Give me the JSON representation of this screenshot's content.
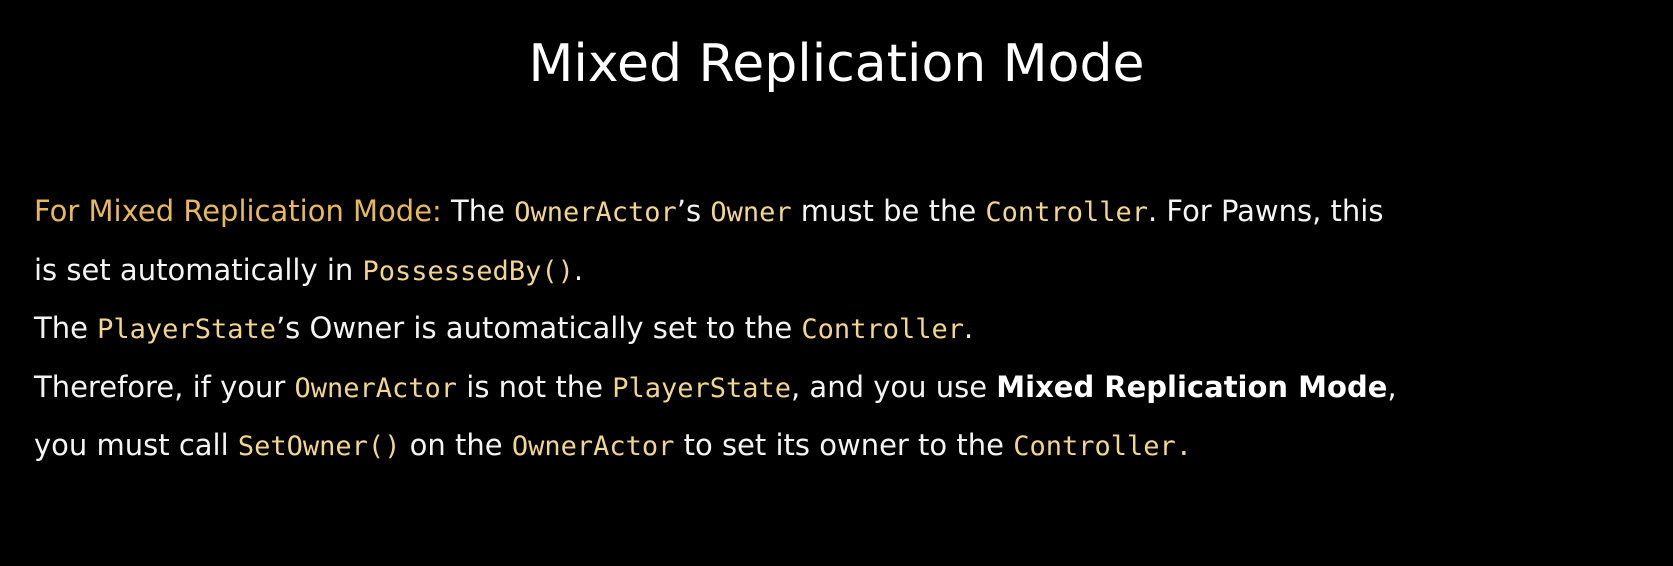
{
  "title": "Mixed Replication Mode",
  "lines": [
    [
      {
        "t": "For Mixed Replication Mode:",
        "s": "lead"
      },
      {
        "t": " The ",
        "s": "text"
      },
      {
        "t": "OwnerActor",
        "s": "code"
      },
      {
        "t": "’s ",
        "s": "text"
      },
      {
        "t": "Owner",
        "s": "code"
      },
      {
        "t": " must be the ",
        "s": "text"
      },
      {
        "t": "Controller",
        "s": "code"
      },
      {
        "t": ". For Pawns, this",
        "s": "text"
      }
    ],
    [
      {
        "t": "is set automatically in ",
        "s": "text"
      },
      {
        "t": "PossessedBy()",
        "s": "code"
      },
      {
        "t": ".",
        "s": "text"
      }
    ],
    [
      {
        "t": "The ",
        "s": "text"
      },
      {
        "t": "PlayerState",
        "s": "code"
      },
      {
        "t": "’s Owner is automatically set to the ",
        "s": "text"
      },
      {
        "t": "Controller",
        "s": "code"
      },
      {
        "t": ".",
        "s": "text"
      }
    ],
    [
      {
        "t": "Therefore, if your ",
        "s": "text"
      },
      {
        "t": "OwnerActor",
        "s": "code"
      },
      {
        "t": " is not the ",
        "s": "text"
      },
      {
        "t": "PlayerState",
        "s": "code"
      },
      {
        "t": ", and you use ",
        "s": "text"
      },
      {
        "t": "Mixed Replication Mode",
        "s": "bold"
      },
      {
        "t": ",",
        "s": "text"
      }
    ],
    [
      {
        "t": "you must call ",
        "s": "text"
      },
      {
        "t": "SetOwner()",
        "s": "code"
      },
      {
        "t": " on the ",
        "s": "text"
      },
      {
        "t": "OwnerActor",
        "s": "code"
      },
      {
        "t": " to set its owner to the ",
        "s": "text"
      },
      {
        "t": "Controller.",
        "s": "code"
      }
    ]
  ],
  "colors": {
    "background": "#000000",
    "text": "#f4f4f4",
    "lead": "#e8b95c",
    "code": "#f2d58e"
  }
}
